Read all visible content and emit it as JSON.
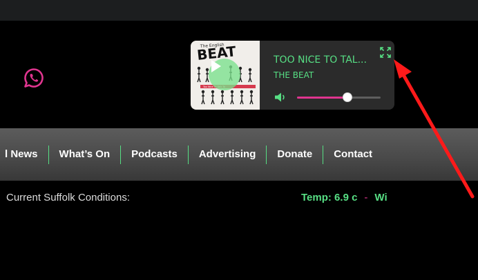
{
  "colors": {
    "accent_green": "#57df84",
    "accent_pink": "#e0358f",
    "arrow_red": "#ff1a1a",
    "background": "#000000",
    "navbar": "#4a4a4a"
  },
  "social": {
    "icon": "whatsapp-icon"
  },
  "player": {
    "track_title": "TOO NICE TO TAL...",
    "artist": "THE BEAT",
    "volume_fraction": 0.6,
    "album_art": {
      "logo_top": "The English",
      "logo_main": "BEAT",
      "banner_text": "Too Nice To Talk To"
    },
    "icons": {
      "play": "play-icon",
      "expand": "expand-icon",
      "volume": "volume-icon"
    }
  },
  "nav": {
    "items": [
      {
        "label": "l News"
      },
      {
        "label": "What’s On"
      },
      {
        "label": "Podcasts"
      },
      {
        "label": "Advertising"
      },
      {
        "label": "Donate"
      },
      {
        "label": "Contact"
      }
    ]
  },
  "conditions": {
    "label": "Current Suffolk Conditions:",
    "temp": "Temp: 6.9 c",
    "separator": "-",
    "wind": "Wi"
  }
}
